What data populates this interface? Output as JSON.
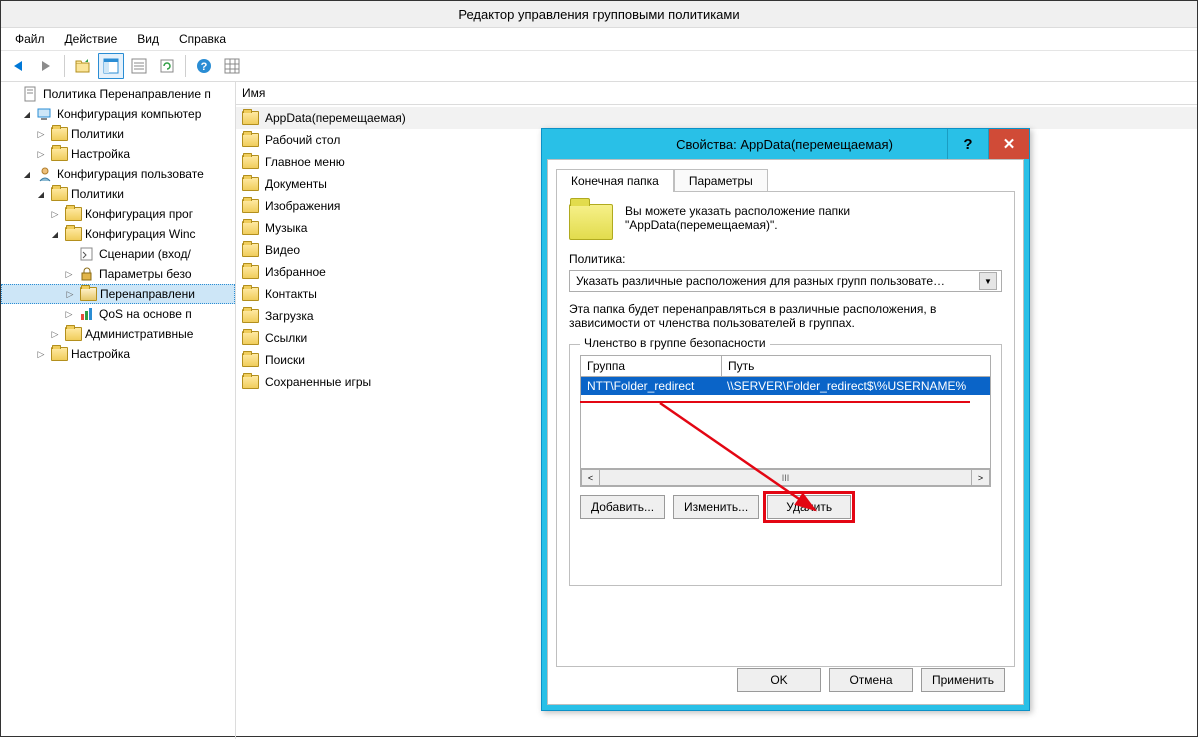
{
  "app": {
    "title": "Редактор управления групповыми политиками"
  },
  "menu": {
    "file": "Файл",
    "action": "Действие",
    "view": "Вид",
    "help": "Справка"
  },
  "toolbar": {
    "back": "back",
    "forward": "forward"
  },
  "tree": {
    "root": "Политика Перенаправление п",
    "cc": "Конфигурация компьютер",
    "cc_pol": "Политики",
    "cc_pref": "Настройка",
    "uc": "Конфигурация пользовате",
    "uc_pol": "Политики",
    "uc_pol_soft": "Конфигурация прог",
    "uc_pol_win": "Конфигурация Winc",
    "uc_pol_win_scripts": "Сценарии (вход/",
    "uc_pol_win_sec": "Параметры безо",
    "uc_pol_win_redir": "Перенаправлени",
    "uc_pol_win_qos": "QoS на основе п",
    "uc_pol_admin": "Административные",
    "uc_pref": "Настройка"
  },
  "list": {
    "header": "Имя",
    "items": [
      "AppData(перемещаемая)",
      "Рабочий стол",
      "Главное меню",
      "Документы",
      "Изображения",
      "Музыка",
      "Видео",
      "Избранное",
      "Контакты",
      "Загрузка",
      "Ссылки",
      "Поиски",
      "Сохраненные игры"
    ]
  },
  "dialog": {
    "title": "Свойства: AppData(перемещаемая)",
    "tab_target": "Конечная папка",
    "tab_settings": "Параметры",
    "info1": "Вы можете указать расположение папки",
    "info2": "\"AppData(перемещаемая)\".",
    "policy_label": "Политика:",
    "policy_value": "Указать различные расположения для разных групп пользовате…",
    "policy_desc": "Эта папка будет перенаправляться в различные расположения, в зависимости от членства пользователей в группах.",
    "groupbox_legend": "Членство в группе безопасности",
    "col_group": "Группа",
    "col_path": "Путь",
    "row_group": "NTT\\Folder_redirect",
    "row_path": "\\\\SERVER\\Folder_redirect$\\%USERNAME%",
    "btn_add": "Добавить...",
    "btn_edit": "Изменить...",
    "btn_remove": "Удалить",
    "btn_ok": "OK",
    "btn_cancel": "Отмена",
    "btn_apply": "Применить"
  }
}
